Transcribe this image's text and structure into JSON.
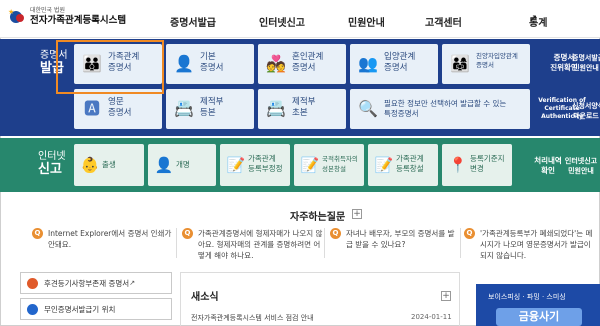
{
  "header": {
    "logo_org": "대한민국 법원",
    "logo_title": "전자가족관계등록시스템",
    "nav": [
      "증명서발급",
      "인터넷신고",
      "민원안내",
      "고객센터",
      "통계"
    ],
    "nav_ext_icon": "external-link-icon"
  },
  "certificate_issue": {
    "label_line1": "증명서",
    "label_line2": "발급",
    "tiles_row1": [
      {
        "label": "가족관계\n증명서",
        "icon": "family-icon"
      },
      {
        "label": "기본\n증명서",
        "icon": "person-icon"
      },
      {
        "label": "혼인관계\n증명서",
        "icon": "couple-icon"
      },
      {
        "label": "입양관계\n증명서",
        "icon": "adoption-icon"
      },
      {
        "label": "친양자입양관계\n증명서",
        "icon": "family-adoption-icon"
      }
    ],
    "tiles_row2": [
      {
        "label": "영문\n증명서",
        "icon": "document-a-icon"
      },
      {
        "label": "제적부\n등본",
        "icon": "register-icon"
      },
      {
        "label": "제적부\n초본",
        "icon": "register-icon"
      },
      {
        "label": "필요한 정보만 선택하여 발급할 수 있는\n특정증명서",
        "icon": "search-document-icon"
      }
    ],
    "right_links": [
      {
        "label": "증명서\n진위확인"
      },
      {
        "label": "증명서발급\n민원안내"
      },
      {
        "label": "Verification of\nCertificate\nAuthenticity"
      },
      {
        "label": "신청서양식\n다운로드"
      }
    ]
  },
  "internet_report": {
    "label_line1": "인터넷",
    "label_line2": "신고",
    "tiles": [
      {
        "label": "출생",
        "icon": "baby-icon"
      },
      {
        "label": "개명",
        "icon": "rename-icon"
      },
      {
        "label": "가족관계\n등록부정정",
        "icon": "document-edit-icon"
      },
      {
        "label": "국적취득자의\n성본창설",
        "icon": "document-edit-icon"
      },
      {
        "label": "가족관계\n등록창설",
        "icon": "document-edit-icon"
      },
      {
        "label": "등록기준지\n변경",
        "icon": "location-icon"
      }
    ],
    "right_links": [
      {
        "label": "처리내역\n확인"
      },
      {
        "label": "인터넷신고\n민원안내"
      }
    ]
  },
  "faq": {
    "title": "자주하는질문",
    "more": "+",
    "items": [
      {
        "q": "Q",
        "text": "Internet Explorer에서 증명서 인쇄가 안돼요."
      },
      {
        "q": "Q",
        "text": "가족관계증명서에 형제자매가 나오지 않아요. 형제자매의 관계를 증명하려면 어떻게 해야 하나요."
      },
      {
        "q": "Q",
        "text": "자녀나 배우자, 부모의 증명서를 발급 받을 수 있나요?"
      },
      {
        "q": "Q",
        "text": "'가족관계등록부가 폐쇄되었다'는 메시지가 나오며 영문증명서가 발급이 되지 않습니다."
      }
    ]
  },
  "bottom": {
    "links": [
      {
        "label": "후견등기사항부존재 증명서",
        "icon": "shortcut-icon"
      },
      {
        "label": "무인증명서발급기 위치",
        "icon": "map-pin-icon"
      }
    ],
    "news": {
      "title": "새소식",
      "more": "+",
      "item": "전자가족관계등록시스템 서비스 점검 안내",
      "date": "2024-01-11"
    },
    "banner": {
      "caption": "보이스피싱 · 파밍 · 스미싱",
      "headline": "금융사기"
    }
  }
}
